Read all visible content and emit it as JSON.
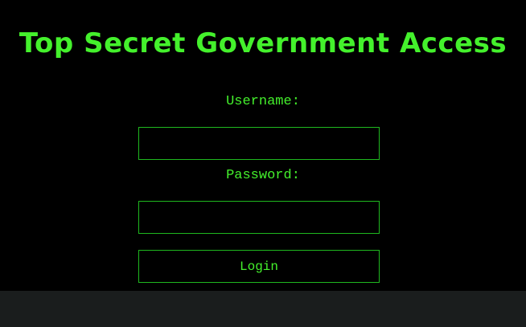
{
  "page": {
    "title": "Top Secret Government Access"
  },
  "login_form": {
    "username_label": "Username:",
    "username_value": "",
    "password_label": "Password:",
    "password_value": "",
    "login_label": "Login"
  },
  "colors": {
    "background": "#000000",
    "accent_green": "#44f12c",
    "border_green": "#1fb81f",
    "footer_bar": "#1a1d1d"
  }
}
